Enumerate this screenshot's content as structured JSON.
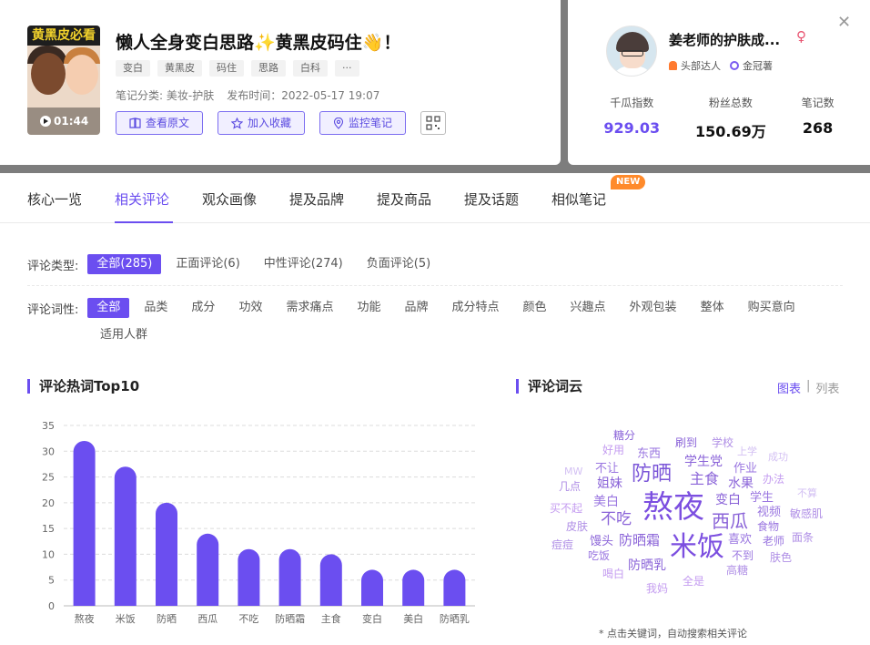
{
  "note": {
    "cover_text": "黄黑皮必看",
    "duration": "01:44",
    "title": "懒人全身变白思路✨黄黑皮码住👋！",
    "tags": [
      "变白",
      "黄黑皮",
      "码住",
      "思路",
      "白科",
      "···"
    ],
    "category": "笔记分类: 美妆-护肤",
    "publish_time": "发布时间：2022-05-17 19:07",
    "actions": {
      "view_original": "查看原文",
      "add_favorite": "加入收藏",
      "monitor_note": "监控笔记"
    }
  },
  "author": {
    "name": "姜老师的护肤成...",
    "gender_symbol": "♀",
    "badge_level": "头部达人",
    "badge_crown": "金冠薯",
    "stats": [
      {
        "label": "千瓜指数",
        "value": "929.03"
      },
      {
        "label": "粉丝总数",
        "value": "150.69万"
      },
      {
        "label": "笔记数",
        "value": "268"
      }
    ]
  },
  "tabs": [
    "核心一览",
    "相关评论",
    "观众画像",
    "提及品牌",
    "提及商品",
    "提及话题",
    "相似笔记"
  ],
  "new_badge": "NEW",
  "filters": {
    "type_label": "评论类型:",
    "types": [
      "全部(285)",
      "正面评论(6)",
      "中性评论(274)",
      "负面评论(5)"
    ],
    "pos_label": "评论词性:",
    "pos": [
      "全部",
      "品类",
      "成分",
      "功效",
      "需求痛点",
      "功能",
      "品牌",
      "成分特点",
      "颜色",
      "兴趣点",
      "外观包装",
      "整体",
      "购买意向",
      "适用人群"
    ]
  },
  "sections": {
    "hotwords_title": "评论热词Top10",
    "cloud_title": "评论词云",
    "view_chart": "图表",
    "view_sep": "|",
    "view_list": "列表",
    "cloud_note": "* 点击关键词，自动搜索相关评论"
  },
  "chart_data": {
    "type": "bar",
    "categories": [
      "熬夜",
      "米饭",
      "防晒",
      "西瓜",
      "不吃",
      "防晒霜",
      "主食",
      "变白",
      "美白",
      "防晒乳"
    ],
    "values": [
      32,
      27,
      20,
      14,
      11,
      11,
      10,
      7,
      7,
      7
    ],
    "ylim": [
      0,
      35
    ],
    "yticks": [
      0,
      5,
      10,
      15,
      20,
      25,
      30,
      35
    ],
    "grid": true,
    "color": "#6b4ef0"
  },
  "word_cloud": [
    {
      "text": "糖分"
    },
    {
      "text": "刷到"
    },
    {
      "text": "学校"
    },
    {
      "text": "好用"
    },
    {
      "text": "东西"
    },
    {
      "text": "上学"
    },
    {
      "text": "学生党"
    },
    {
      "text": "成功"
    },
    {
      "text": "MW"
    },
    {
      "text": "不让"
    },
    {
      "text": "防晒"
    },
    {
      "text": "主食"
    },
    {
      "text": "作业"
    },
    {
      "text": "几点"
    },
    {
      "text": "姐妹"
    },
    {
      "text": "水果"
    },
    {
      "text": "办法"
    },
    {
      "text": "不算"
    },
    {
      "text": "美白"
    },
    {
      "text": "熬夜"
    },
    {
      "text": "变白"
    },
    {
      "text": "学生"
    },
    {
      "text": "买不起"
    },
    {
      "text": "不吃"
    },
    {
      "text": "西瓜"
    },
    {
      "text": "视频"
    },
    {
      "text": "敏感肌"
    },
    {
      "text": "皮肤"
    },
    {
      "text": "食物"
    },
    {
      "text": "馒头"
    },
    {
      "text": "防晒霜"
    },
    {
      "text": "米饭"
    },
    {
      "text": "喜欢"
    },
    {
      "text": "面条"
    },
    {
      "text": "痘痘"
    },
    {
      "text": "老师"
    },
    {
      "text": "吃饭"
    },
    {
      "text": "不到"
    },
    {
      "text": "肤色"
    },
    {
      "text": "防晒乳"
    },
    {
      "text": "喝白"
    },
    {
      "text": "高糖"
    },
    {
      "text": "全是"
    },
    {
      "text": "我妈"
    }
  ]
}
